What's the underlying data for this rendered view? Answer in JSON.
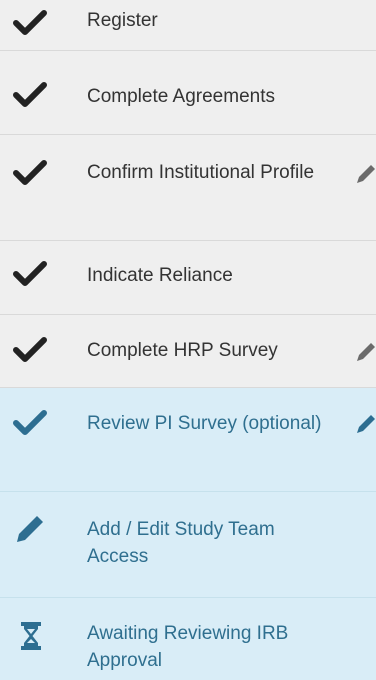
{
  "steps": [
    {
      "label": "Register",
      "icon": "check-icon",
      "status": "complete",
      "editable": false
    },
    {
      "label": "Complete Agreements",
      "icon": "check-icon",
      "status": "complete",
      "editable": false
    },
    {
      "label": "Confirm Institutional Profile",
      "icon": "check-icon",
      "status": "complete",
      "editable": true
    },
    {
      "label": "Indicate Reliance",
      "icon": "check-icon",
      "status": "complete",
      "editable": false
    },
    {
      "label": "Complete HRP Survey",
      "icon": "check-icon",
      "status": "complete",
      "editable": true
    },
    {
      "label": "Review PI Survey (optional)",
      "icon": "check-icon",
      "status": "complete",
      "editable": true
    },
    {
      "label": "Add / Edit Study Team Access",
      "icon": "pencil-icon",
      "status": "active",
      "editable": false
    },
    {
      "label": "Awaiting Reviewing IRB Approval",
      "icon": "hourglass-icon",
      "status": "pending",
      "editable": false
    }
  ],
  "colors": {
    "done_background": "#efefef",
    "current_background": "#d9edf7",
    "done_icon": "#222222",
    "current_icon": "#2d6e91",
    "done_text": "#333333",
    "current_text": "#2f6f8f",
    "edit_icon": "#6b6b6b",
    "edit_icon_current": "#2d6e91"
  }
}
